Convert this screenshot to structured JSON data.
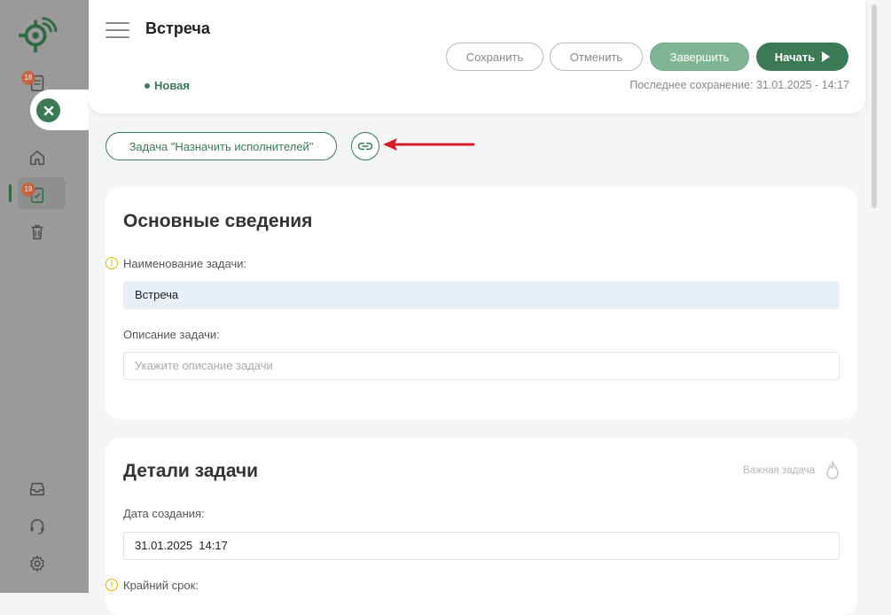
{
  "header": {
    "title": "Встреча",
    "status": "Новая",
    "last_saved": "Последнее сохранение: 31.01.2025 - 14:17",
    "buttons": {
      "save": "Сохранить",
      "cancel": "Отменить",
      "finish": "Завершить",
      "start": "Начать"
    }
  },
  "sidebar": {
    "badges": {
      "documents": "18",
      "tasks": "19"
    },
    "icons": [
      "logo-icon",
      "documents-icon",
      "home-icon",
      "tasks-icon",
      "trash-icon",
      "inbox-icon",
      "support-icon",
      "settings-icon"
    ]
  },
  "task_link": {
    "label": "Задача \"Назначить исполнителей\""
  },
  "basic_info": {
    "title": "Основные сведения",
    "name_label": "Наименование задачи:",
    "name_value": "Встреча",
    "description_label": "Описание задачи:",
    "description_placeholder": "Укажите описание задачи"
  },
  "details": {
    "title": "Детали задачи",
    "important_label": "Важная задача",
    "created_label": "Дата создания:",
    "created_value": "31.01.2025  14:17",
    "deadline_label": "Крайний срок:"
  },
  "colors": {
    "accent": "#3b7a55",
    "accent_light": "#7fb594",
    "sidebar": "#9a9a9a",
    "arrow": "#d81e2a",
    "warning": "#e0b400"
  }
}
